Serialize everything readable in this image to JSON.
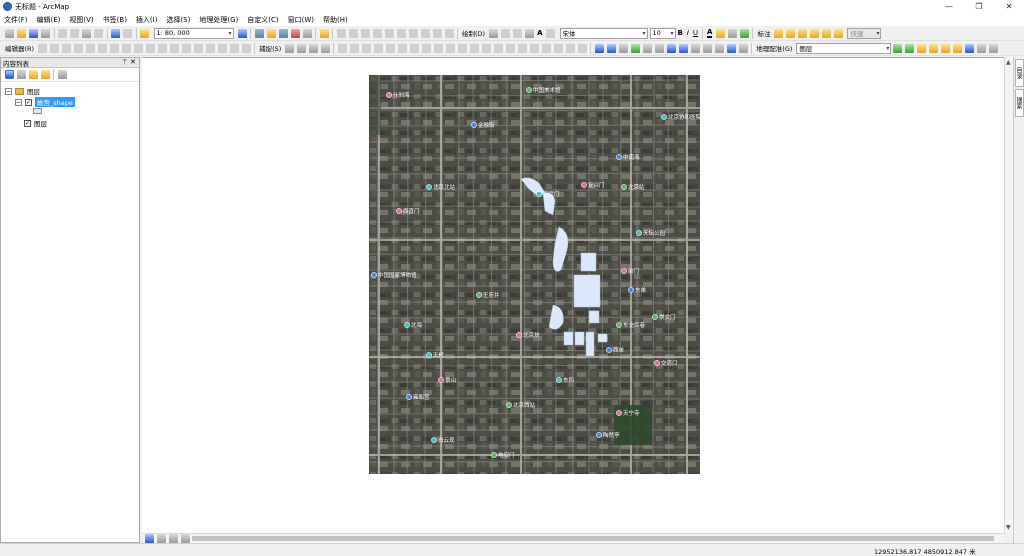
{
  "window": {
    "title": "无标题 - ArcMap",
    "controls": [
      "—",
      "❐",
      "✕"
    ]
  },
  "menu": [
    "文件(F)",
    "编辑(E)",
    "视图(V)",
    "书签(B)",
    "插入(I)",
    "选择(S)",
    "地理处理(G)",
    "自定义(C)",
    "窗口(W)",
    "帮助(H)"
  ],
  "toolbar": {
    "scale_value": "1: 80, 000",
    "draw_label": "绘制(D)",
    "font_name": "宋体",
    "font_size": "10",
    "bold": "B",
    "italic": "I",
    "underline": "U",
    "label_btn": "标注",
    "fast_label": "快速",
    "editor_label": "编辑器(R)",
    "snap_label": "捕捉(S)",
    "georef_label": "地理配准(G)",
    "georef_layer": "图层"
  },
  "toc": {
    "title": "内容列表",
    "pin": "ᛘ",
    "close": "✕",
    "layers_root": "图层",
    "layer_shape": "故宫_shape",
    "layer_image": "图层"
  },
  "map": {
    "places": [
      "北京北站",
      "西直门",
      "中南海",
      "北京站",
      "天坛公园",
      "前门",
      "东单",
      "崇文门",
      "宣武门",
      "复兴门",
      "西单",
      "王府井",
      "北海",
      "景山",
      "雍和宫",
      "北京西站",
      "白云观",
      "天宁寺",
      "陶然亭",
      "地安门",
      "东四",
      "交道口",
      "金融街",
      "中国美术馆",
      "北京协和医院",
      "什刹海",
      "中国国家博物馆",
      "东交民巷",
      "天桥",
      "北京坊"
    ]
  },
  "right_dock": [
    "目录",
    "搜索"
  ],
  "status": {
    "coords": "12952136.817   4850912.847 米"
  }
}
